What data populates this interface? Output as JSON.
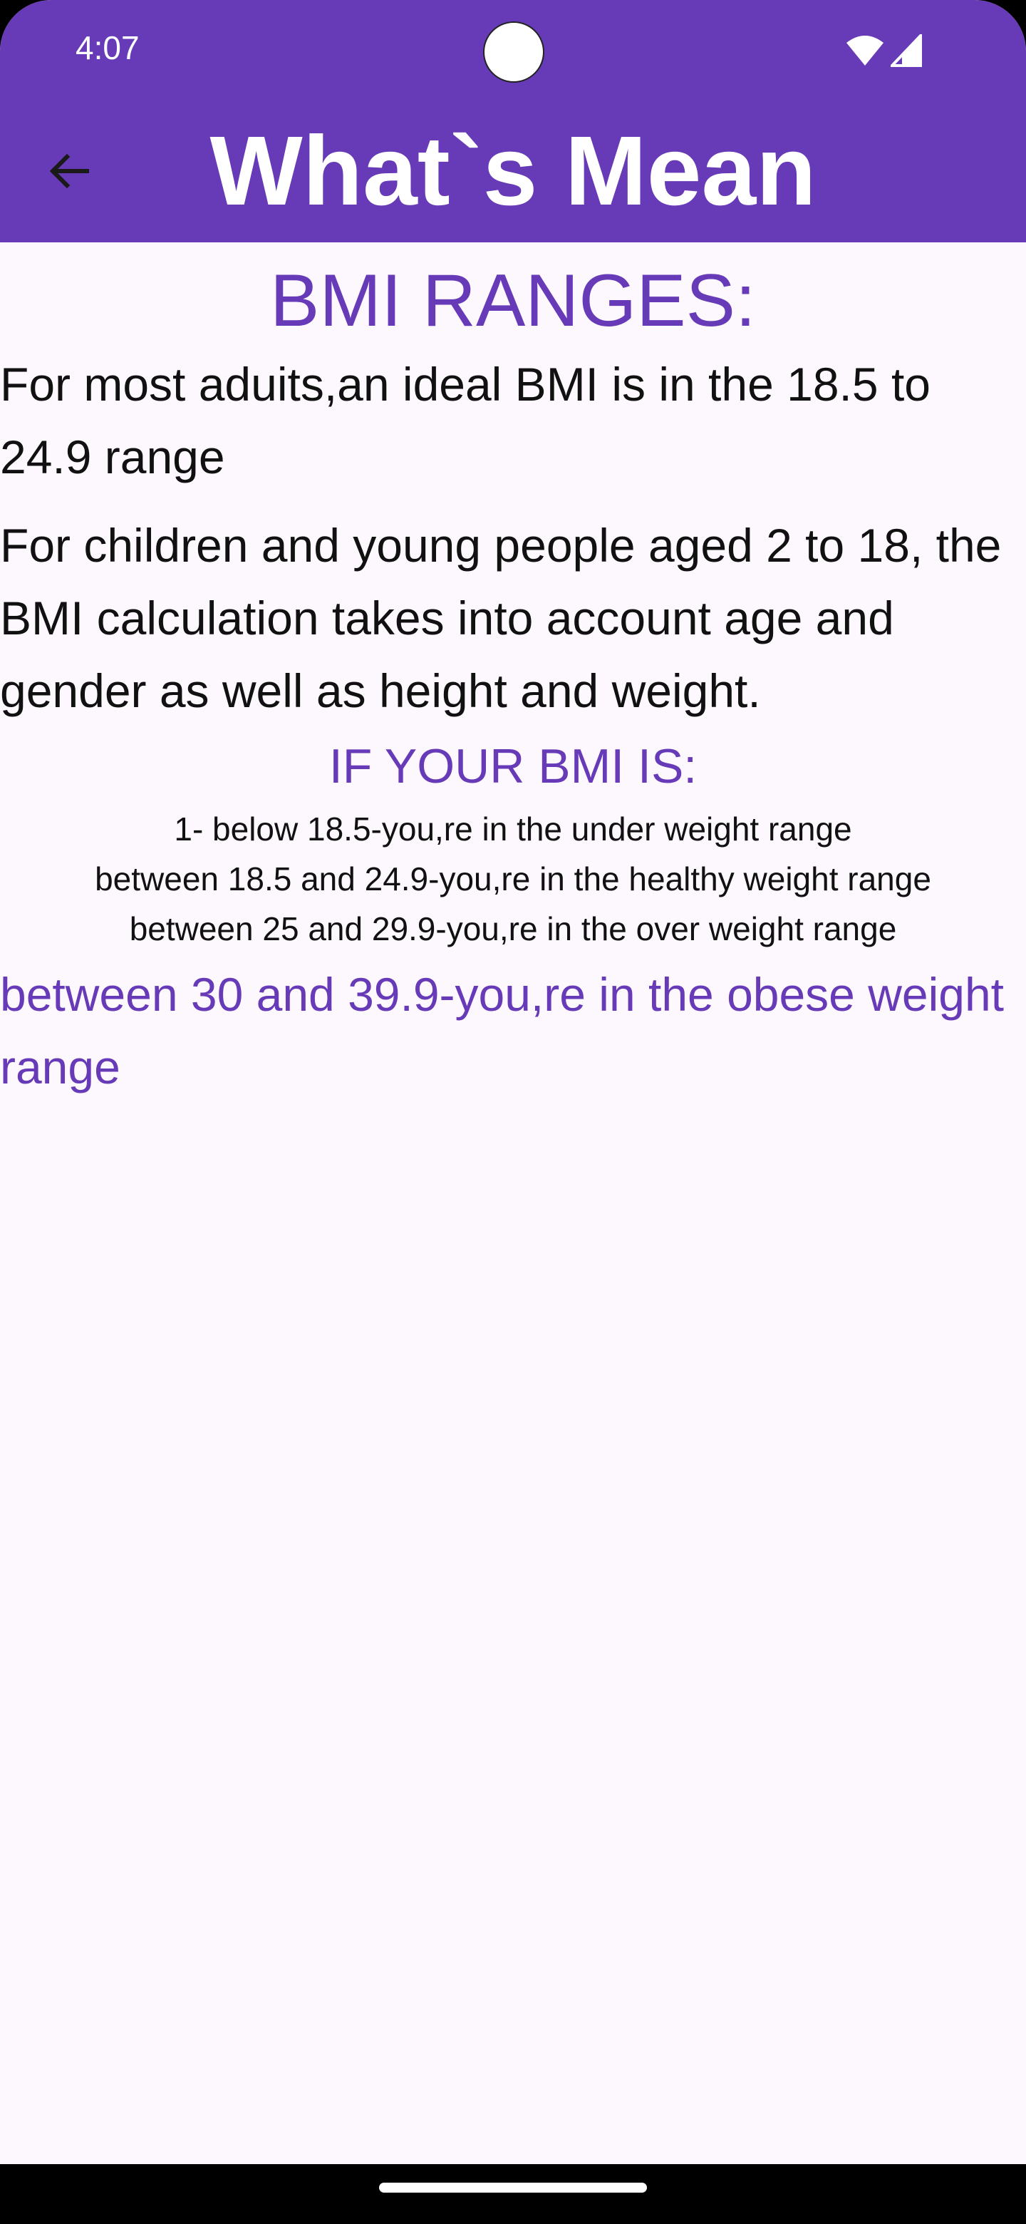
{
  "status_bar": {
    "time": "4:07",
    "icons": [
      "wifi-icon",
      "signal-icon"
    ]
  },
  "app_bar": {
    "title": "What`s Mean",
    "back_icon": "arrow-back-icon"
  },
  "content": {
    "heading": "BMI RANGES:",
    "paragraph_adults": "For most aduits,an ideal BMI is in the 18.5 to 24.9 range",
    "paragraph_children": "For children and young people aged 2 to 18, the BMI calculation takes into account age and gender as well as height and weight.",
    "subheading": "IF YOUR BMI IS:",
    "ranges": [
      "1- below 18.5-you,re in the under weight range",
      "between 18.5 and 24.9-you,re in the healthy weight range",
      "between 25 and 29.9-you,re in the over weight range"
    ],
    "obese_line": "between 30 and 39.9-you,re in the obese weight range"
  },
  "colors": {
    "primary": "#673AB7",
    "background": "#FDF7FE",
    "text": "#111111"
  }
}
